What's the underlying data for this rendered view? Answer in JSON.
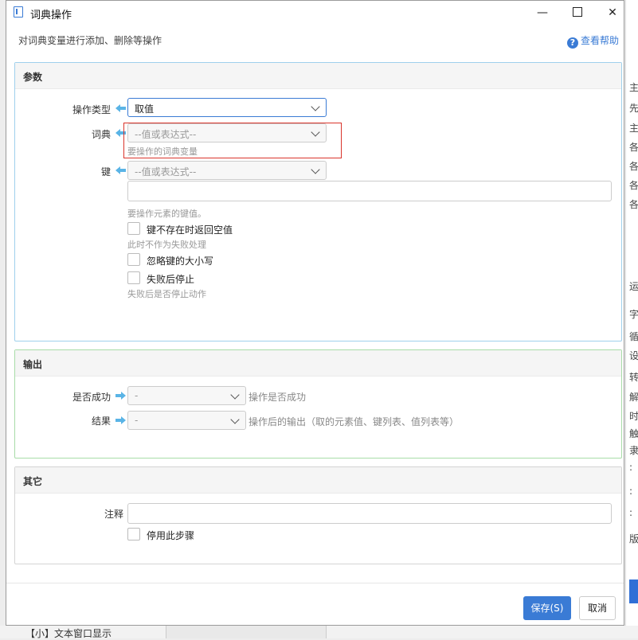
{
  "dialog": {
    "title": "词典操作",
    "subtitle": "对词典变量进行添加、删除等操作",
    "help_label": "查看帮助",
    "window_controls": {
      "minimize": "—",
      "close": "✕"
    }
  },
  "params": {
    "header": "参数",
    "operation_type": {
      "label": "操作类型",
      "value": "取值"
    },
    "dictionary": {
      "label": "词典",
      "placeholder": "--值或表达式--",
      "hint": "要操作的词典变量"
    },
    "key": {
      "label": "键",
      "placeholder": "--值或表达式--",
      "hint": "要操作元素的键值。"
    },
    "checkbox_return_null": {
      "label": "键不存在时返回空值",
      "hint": "此时不作为失败处理",
      "checked": false
    },
    "checkbox_ignore_case": {
      "label": "忽略键的大小写",
      "checked": false
    },
    "checkbox_stop_on_fail": {
      "label": "失败后停止",
      "hint": "失败后是否停止动作",
      "checked": false
    }
  },
  "output": {
    "header": "输出",
    "success": {
      "label": "是否成功",
      "value": "-",
      "desc": "操作是否成功"
    },
    "result": {
      "label": "结果",
      "value": "-",
      "desc": "操作后的输出（取的元素值、键列表、值列表等）"
    }
  },
  "other": {
    "header": "其它",
    "comment": {
      "label": "注释",
      "value": ""
    },
    "disable_step": {
      "label": "停用此步骤",
      "checked": false
    }
  },
  "buttons": {
    "save": "保存(S)",
    "cancel": "取消"
  },
  "background": {
    "right_chars": [
      "主",
      "先",
      "主",
      "各",
      "各",
      "各",
      "各",
      "运",
      "字",
      "循",
      "设",
      "转",
      "解",
      "时",
      "触",
      "隶",
      ":",
      ":",
      ":",
      "版"
    ],
    "bottom_text": "【小】文本窗口显示"
  },
  "colors": {
    "accent": "#3a7bd5",
    "params_border": "#9fd0ec",
    "output_border": "#a8dca8",
    "highlight": "#d9342b",
    "arrow": "#5ab4e6"
  }
}
